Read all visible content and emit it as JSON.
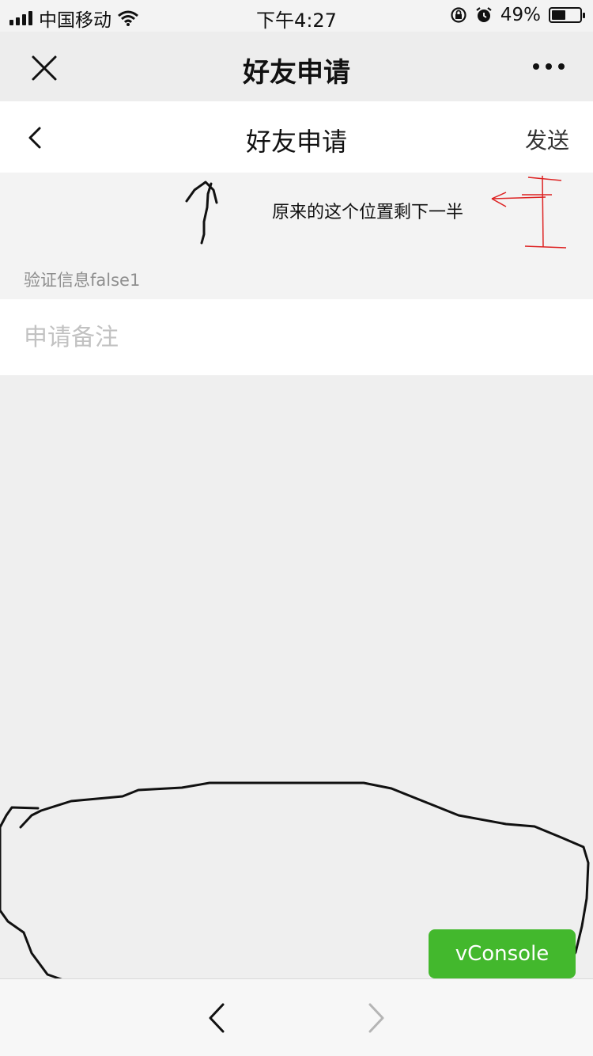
{
  "status_bar": {
    "carrier": "中国移动",
    "time": "下午4:27",
    "battery_percent": "49%",
    "battery_level": 0.49,
    "icons": [
      "signal-icon",
      "wifi-icon",
      "lock-rotation-icon",
      "alarm-icon",
      "battery-icon"
    ]
  },
  "webview_header": {
    "title": "好友申请",
    "close_icon": "close-icon",
    "more_icon": "more-icon"
  },
  "app_nav": {
    "title": "好友申请",
    "back_icon": "back-icon",
    "send_label": "发送"
  },
  "annotation": {
    "text": "原来的这个位置剩下一半"
  },
  "form": {
    "section_label": "验证信息false1",
    "remark_placeholder": "申请备注",
    "remark_value": ""
  },
  "vconsole": {
    "label": "vConsole",
    "color": "#43b82d"
  },
  "toolbar": {
    "back_icon": "chevron-left-icon",
    "forward_icon": "chevron-right-icon"
  }
}
